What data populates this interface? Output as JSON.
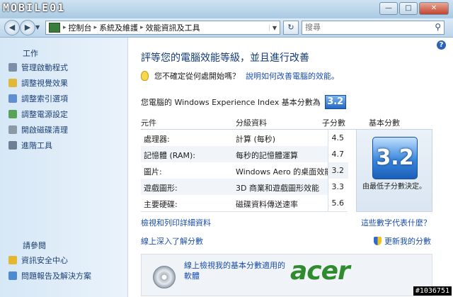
{
  "watermark": "MOBILE01",
  "window": {
    "minimize": "—",
    "maximize": "□",
    "close": "✕"
  },
  "nav": {
    "back": "◀",
    "forward": "▶",
    "breadcrumbs": [
      "控制台",
      "系統及維護",
      "效能資訊及工具"
    ],
    "search_placeholder": "搜尋",
    "refresh": "↻"
  },
  "sidebar": {
    "tasks_title": "工作",
    "items": [
      {
        "label": "管理啟動程式",
        "icon": "startup-icon",
        "color": "#7b8fa6"
      },
      {
        "label": "調整視覺效果",
        "icon": "visual-effects-shield-icon",
        "color": "#e0b83a"
      },
      {
        "label": "調整索引選項",
        "icon": "index-options-shield-icon",
        "color": "#5f8ed1"
      },
      {
        "label": "調整電源設定",
        "icon": "power-settings-icon",
        "color": "#5aa25a"
      },
      {
        "label": "開啟磁碟清理",
        "icon": "disk-cleanup-icon",
        "color": "#8c9aa8"
      },
      {
        "label": "進階工具",
        "icon": "advanced-tools-icon",
        "color": "#6d7f95"
      }
    ],
    "see_also_title": "請參閱",
    "see_also": [
      {
        "label": "資訊安全中心",
        "icon": "security-center-icon",
        "color": "#e7b62f"
      },
      {
        "label": "問題報告及解決方案",
        "icon": "problem-reports-icon",
        "color": "#4c8bd0"
      }
    ]
  },
  "main": {
    "heading": "評等您的電腦效能等級，並且進行改善",
    "tip_text": "您不確定從何處開始嗎？",
    "tip_link": "說明如何改善電腦的效能。",
    "score_label": "您電腦的 Windows Experience Index 基本分數為",
    "base_score": "3.2",
    "table_headers": {
      "component": "元件",
      "rated": "分級資料",
      "subscore": "子分數",
      "basescore": "基本分數"
    },
    "rows": [
      {
        "component": "處理器:",
        "rated": "計算 (每秒)",
        "score": "4.5"
      },
      {
        "component": "記憶體 (RAM):",
        "rated": "每秒的記憶體運算",
        "score": "4.7"
      },
      {
        "component": "圖片:",
        "rated": "Windows Aero 的桌面效能",
        "score": "3.2"
      },
      {
        "component": "遊戲圖形:",
        "rated": "3D 商業和遊戲圖形效能",
        "score": "3.3"
      },
      {
        "component": "主要硬碟:",
        "rated": "磁碟資料傳送速率",
        "score": "5.6"
      }
    ],
    "base_caption": "由最低子分數決定。",
    "link_details": "檢視和列印詳細資料",
    "link_meaning": "這些數字代表什麼？",
    "link_online": "線上深入了解分數",
    "link_update": "更新我的分數",
    "banner_text": "線上檢視我的基本分數適用的軟體",
    "acer_logo": "acer"
  },
  "stamp": "#1036751"
}
